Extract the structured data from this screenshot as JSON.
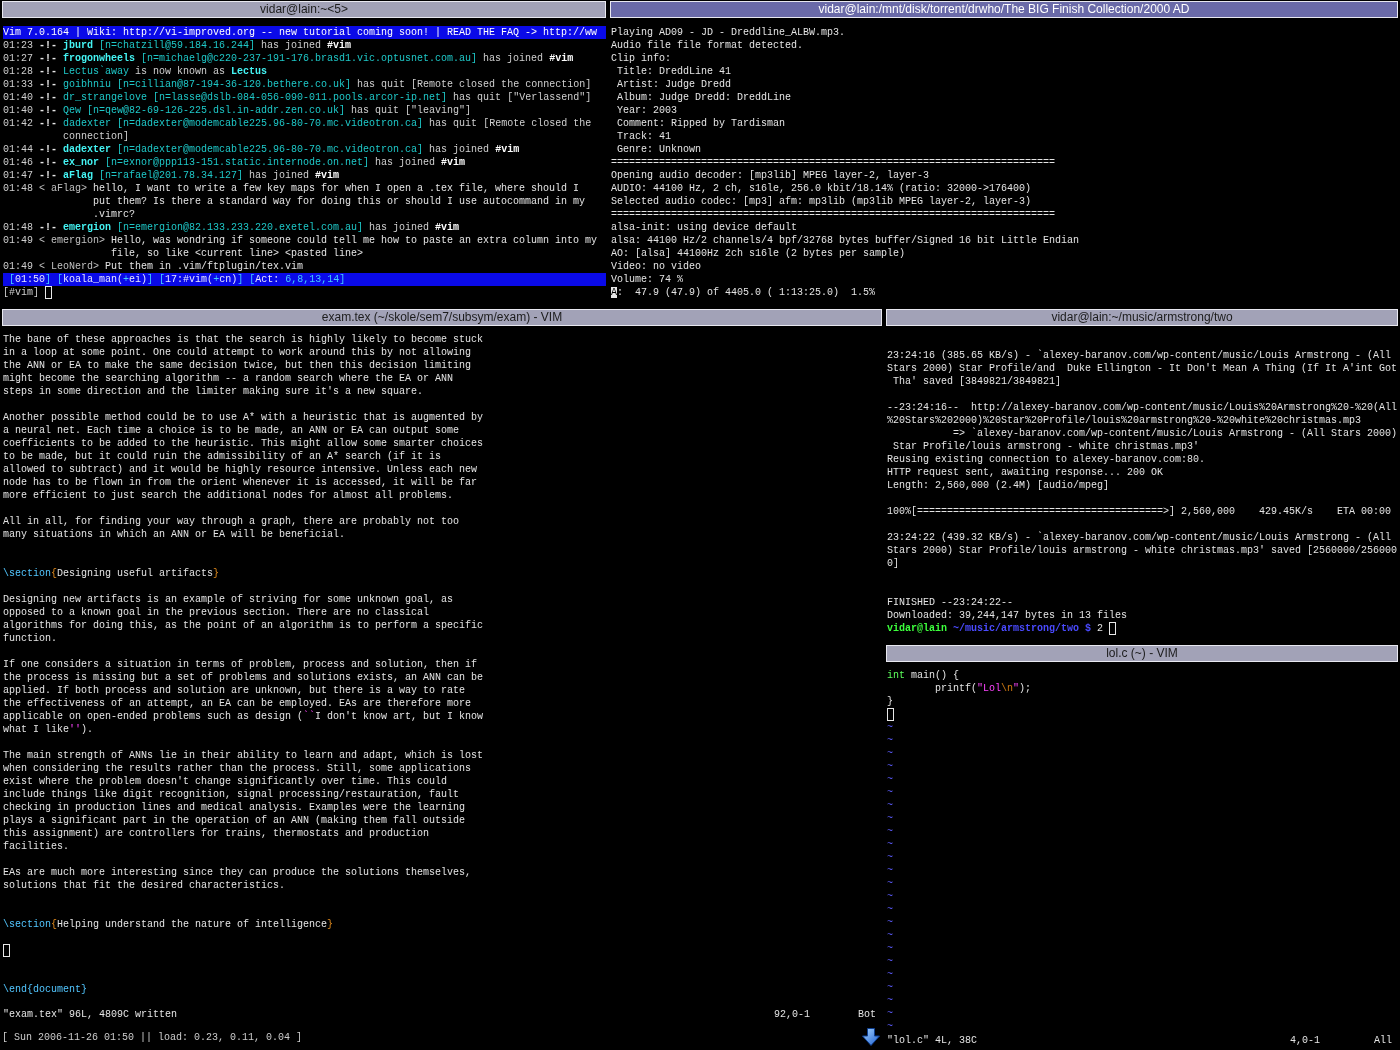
{
  "irc": {
    "title": "vidar@lain:~<5>",
    "focused": false,
    "topic": "Vim 7.0.164 | Wiki: http://vi-improved.org -- new tutorial coming soon! | READ THE FAQ -> http://ww",
    "lines": [
      {
        "time": "01:23",
        "kind": "join",
        "lead": "-!-",
        "nick": "jburd",
        "host": "[n=chatzill@59.184.16.244]",
        "action": "has joined",
        "target": "#vim"
      },
      {
        "time": "01:27",
        "kind": "join",
        "lead": "-!-",
        "nick": "frogonwheels",
        "host": "[n=michaelg@c220-237-191-176.brasd1.vic.optusnet.com.au]",
        "action": "has joined",
        "target": "#vim"
      },
      {
        "time": "01:28",
        "kind": "nick",
        "lead": "-!-",
        "nick": "Lectus`away",
        "action": "is now known as",
        "target": "Lectus"
      },
      {
        "time": "01:33",
        "kind": "quit",
        "lead": "-!-",
        "nick": "goibhniu",
        "host": "[n=cillian@87-194-36-120.bethere.co.uk]",
        "action": "has quit",
        "target": "[Remote closed the connection]"
      },
      {
        "time": "01:40",
        "kind": "quit",
        "lead": "-!-",
        "nick": "dr_strangelove",
        "host": "[n=lasse@dslb-084-056-090-011.pools.arcor-ip.net]",
        "action": "has quit",
        "target": "[\"Verlassend\"]"
      },
      {
        "time": "01:40",
        "kind": "quit",
        "lead": "-!-",
        "nick": "Qew",
        "host": "[n=qew@82-69-126-225.dsl.in-addr.zen.co.uk]",
        "action": "has quit",
        "target": "[\"leaving\"]"
      },
      {
        "time": "01:42",
        "kind": "quit",
        "lead": "-!-",
        "nick": "dadexter",
        "host": "[n=dadexter@modemcable225.96-80-70.mc.videotron.ca]",
        "action": "has quit",
        "target": "[Remote closed the\nconnection]"
      },
      {
        "time": "01:44",
        "kind": "join",
        "lead": "-!-",
        "nick": "dadexter",
        "host": "[n=dadexter@modemcable225.96-80-70.mc.videotron.ca]",
        "action": "has joined",
        "target": "#vim"
      },
      {
        "time": "01:46",
        "kind": "join",
        "lead": "-!-",
        "nick": "ex_nor",
        "host": "[n=exnor@ppp113-151.static.internode.on.net]",
        "action": "has joined",
        "target": "#vim"
      },
      {
        "time": "01:47",
        "kind": "join",
        "lead": "-!-",
        "nick": "aFlag",
        "host": "[n=rafael@201.78.34.127]",
        "action": "has joined",
        "target": "#vim"
      },
      {
        "time": "01:48",
        "kind": "message",
        "lead": "< aFlag>",
        "text": "hello, I want to write a few key maps for when I open a .tex file, where should I\nput them? Is there a standard way for doing this or should I use autocommand in my\n.vimrc?"
      },
      {
        "time": "01:48",
        "kind": "join",
        "lead": "-!-",
        "nick": "emergion",
        "host": "[n=emergion@82.133.233.220.exetel.com.au]",
        "action": "has joined",
        "target": "#vim"
      },
      {
        "time": "01:49",
        "kind": "message",
        "lead": "< emergion>",
        "text": "Hello, was wondring if someone could tell me how to paste an extra column into my\nfile, so like <current line> <pasted line>"
      },
      {
        "time": "01:49",
        "kind": "message",
        "lead": "< LeoNerd>",
        "text": "Put them in .vim/ftplugin/tex.vim"
      }
    ],
    "status": [
      {
        "text": "[",
        "kind": "bracket"
      },
      {
        "text": "01:50",
        "kind": "text"
      },
      {
        "text": "] [",
        "kind": "bracket"
      },
      {
        "text": "koala_man(",
        "kind": "text"
      },
      {
        "text": "+",
        "kind": "bracket"
      },
      {
        "text": "ei)",
        "kind": "text"
      },
      {
        "text": "] [",
        "kind": "bracket"
      },
      {
        "text": "17:#vim(",
        "kind": "text"
      },
      {
        "text": "+",
        "kind": "bracket"
      },
      {
        "text": "cn)",
        "kind": "text"
      },
      {
        "text": "] [",
        "kind": "bracket"
      },
      {
        "text": "Act: ",
        "kind": "text"
      },
      {
        "text": "6,8,13,14",
        "kind": "bracket"
      },
      {
        "text": "]",
        "kind": "bracket"
      }
    ],
    "prompt": "[#vim]"
  },
  "player": {
    "title": "vidar@lain:/mnt/disk/torrent/drwho/The BIG Finish Collection/2000 AD",
    "focused": true,
    "lines": [
      "Playing AD09 - JD - Dreddline_ALBW.mp3.",
      "Audio file file format detected.",
      "Clip info:",
      " Title: DreddLine 41",
      " Artist: Judge Dredd",
      " Album: Judge Dredd: DreddLine",
      " Year: 2003",
      " Comment: Ripped by Tardisman",
      " Track: 41",
      " Genre: Unknown",
      "==========================================================================",
      "Opening audio decoder: [mp3lib] MPEG layer-2, layer-3",
      "AUDIO: 44100 Hz, 2 ch, s16le, 256.0 kbit/18.14% (ratio: 32000->176400)",
      "Selected audio codec: [mp3] afm: mp3lib (mp3lib MPEG layer-2, layer-3)",
      "==========================================================================",
      "alsa-init: using device default",
      "alsa: 44100 Hz/2 channels/4 bpf/32768 bytes buffer/Signed 16 bit Little Endian",
      "AO: [alsa] 44100Hz 2ch s16le (2 bytes per sample)",
      "Video: no video",
      "Volume: 74 %"
    ],
    "status": [
      {
        "text": "A",
        "kind": "cursor"
      },
      {
        "text": ":  47.9 (47.9) of 4405.0 ( 1:13:25.0)  1.5%",
        "kind": "text"
      }
    ]
  },
  "editor": {
    "title": "exam.tex (~/skole/sem7/subsym/exam) - VIM",
    "focused": false,
    "blocks": [
      {
        "kind": "prose",
        "text": "The bane of these approaches is that the search is highly likely to become stuck\nin a loop at some point. One could attempt to work around this by not allowing\nthe ANN or EA to make the same decision twice, but then this decision limiting\nmight become the searching algorithm -- a random search where the EA or ANN\nsteps in some direction and the limiter making sure it's a new square."
      },
      {
        "kind": "prose",
        "text": "Another possible method could be to use A* with a heuristic that is augmented by\na neural net. Each time a choice is to be made, an ANN or EA can output some\ncoefficients to be added to the heuristic. This might allow some smarter choices\nto be made, but it could ruin the admissibility of an A* search (if it is\nallowed to subtract) and it would be highly resource intensive. Unless each new\nnode has to be flown in from the orient whenever it is accessed, it will be far\nmore efficient to just search the additional nodes for almost all problems."
      },
      {
        "kind": "prose",
        "text": "All in all, for finding your way through a graph, there are probably not too\nmany situations in which an ANN or EA will be beneficial."
      },
      {
        "kind": "section",
        "segments": [
          {
            "text": "\\section",
            "kind": "keyword"
          },
          {
            "text": "{",
            "kind": "brace"
          },
          {
            "text": "Designing useful artifacts",
            "kind": "text"
          },
          {
            "text": "}",
            "kind": "brace"
          }
        ]
      },
      {
        "kind": "prose",
        "text": "Designing new artifacts is an example of striving for some unknown goal, as\nopposed to a known goal in the previous section. There are no classical\nalgorithms for doing this, as the point of an algorithm is to perform a specific\nfunction."
      },
      {
        "kind": "prose",
        "segments": [
          {
            "text": "If one considers a situation in terms of problem, process and solution, then if\nthe process is missing but a set of problems and solutions exists, an ANN can be\napplied. If both process and solution are unknown, but there is a way to rate\nthe effectiveness of an attempt, an EA can be employed. EAs are therefore more\napplicable on open-ended problems such as design (",
            "kind": "text"
          },
          {
            "text": "``",
            "kind": "quote"
          },
          {
            "text": "I don't know art, but I know\nwhat I like",
            "kind": "text"
          },
          {
            "text": "''",
            "kind": "quote"
          },
          {
            "text": ").",
            "kind": "text"
          }
        ]
      },
      {
        "kind": "prose",
        "text": "The main strength of ANNs lie in their ability to learn and adapt, which is lost\nwhen considering the results rather than the process. Still, some applications\nexist where the problem doesn't change significantly over time. This could\ninclude things like digit recognition, signal processing/restauration, fault\nchecking in production lines and medical analysis. Examples were the learning\nplays a significant part in the operation of an ANN (making them fall outside\nthis assignment) are controllers for trains, thermostats and production\nfacilities."
      },
      {
        "kind": "prose",
        "text": "EAs are much more interesting since they can produce the solutions themselves,\nsolutions that fit the desired characteristics."
      },
      {
        "kind": "section",
        "segments": [
          {
            "text": "\\section",
            "kind": "keyword"
          },
          {
            "text": "{",
            "kind": "brace"
          },
          {
            "text": "Helping understand the nature of intelligence",
            "kind": "text"
          },
          {
            "text": "}",
            "kind": "brace"
          }
        ]
      },
      {
        "kind": "cursor"
      },
      {
        "kind": "end",
        "segments": [
          {
            "text": "\\end{document}",
            "kind": "keyword"
          }
        ]
      }
    ],
    "message": "\"exam.tex\" 96L, 4809C written",
    "ruler": "92,0-1",
    "position": "Bot"
  },
  "downloads": {
    "title": "vidar@lain:~/music/armstrong/two",
    "focused": false,
    "blocks": [
      {
        "kind": "log",
        "lines": [
          "23:24:16 (385.65 KB/s) - `alexey-baranov.com/wp-content/music/Louis Armstrong - (All\nStars 2000) Star Profile/and  Duke Ellington - It Don't Mean A Thing (If It A'int Got\n Tha' saved [3849821/3849821]"
        ]
      },
      {
        "kind": "log",
        "lines": [
          "--23:24:16--  http://alexey-baranov.com/wp-content/music/Louis%20Armstrong%20-%20(All\n%20Stars%202000)%20Star%20Profile/louis%20armstrong%20-%20white%20christmas.mp3\n           => `alexey-baranov.com/wp-content/music/Louis Armstrong - (All Stars 2000)\n Star Profile/louis armstrong - white christmas.mp3'",
          "Reusing existing connection to alexey-baranov.com:80.",
          "HTTP request sent, awaiting response... 200 OK",
          "Length: 2,560,000 (2.4M) [audio/mpeg]"
        ]
      },
      {
        "kind": "log",
        "lines": [
          "100%[=========================================>] 2,560,000    429.45K/s    ETA 00:00"
        ]
      },
      {
        "kind": "log",
        "lines": [
          "23:24:22 (439.32 KB/s) - `alexey-baranov.com/wp-content/music/Louis Armstrong - (All\nStars 2000) Star Profile/louis armstrong - white christmas.mp3' saved [2560000/256000\n0]"
        ]
      },
      {
        "kind": "summary",
        "lines": [
          "FINISHED --23:24:22--",
          "Downloaded: 39,244,147 bytes in 13 files"
        ]
      }
    ],
    "prompt": [
      {
        "text": "vidar@lain",
        "kind": "user"
      },
      {
        "text": " ~/music/armstrong/two $",
        "kind": "path"
      },
      {
        "text": " 2",
        "kind": "text"
      }
    ]
  },
  "code": {
    "title": "lol.c (~) - VIM",
    "focused": false,
    "lines": [
      {
        "kind": "code",
        "segments": [
          {
            "text": "int",
            "kind": "type"
          },
          {
            "text": " main() {",
            "kind": "text"
          }
        ]
      },
      {
        "kind": "code",
        "segments": [
          {
            "text": "        printf(",
            "kind": "text"
          },
          {
            "text": "\"Lol",
            "kind": "string"
          },
          {
            "text": "\\n",
            "kind": "special"
          },
          {
            "text": "\"",
            "kind": "string"
          },
          {
            "text": ");",
            "kind": "text"
          }
        ]
      },
      {
        "kind": "code",
        "segments": [
          {
            "text": "}",
            "kind": "text"
          }
        ]
      },
      {
        "kind": "cursor"
      }
    ],
    "filler": [
      "~",
      "~",
      "~",
      "~",
      "~",
      "~",
      "~",
      "~",
      "~",
      "~",
      "~",
      "~",
      "~",
      "~",
      "~",
      "~",
      "~",
      "~",
      "~",
      "~",
      "~",
      "~",
      "~",
      "~"
    ],
    "message": "\"lol.c\" 4L, 38C",
    "ruler": "4,0-1",
    "position": "All"
  },
  "status_bar": {
    "text": "[ Sun 2006-11-26 01:50 || load: 0.23, 0.11, 0.04 ]"
  }
}
